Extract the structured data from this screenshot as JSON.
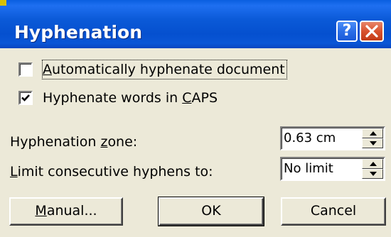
{
  "dialog": {
    "title": "Hyphenation",
    "help_glyph": "?",
    "close_icon": "close-x-icon",
    "colors": {
      "titlebar": "#0550cf",
      "close": "#d9532f",
      "face": "#ece9d8"
    }
  },
  "options": {
    "auto_hyphenate": {
      "label_pre": "",
      "label_key": "A",
      "label_post": "utomatically hyphenate document",
      "checked": false
    },
    "hyphenate_caps": {
      "label_pre": "Hyphenate words in ",
      "label_key": "C",
      "label_post": "APS",
      "checked": true
    }
  },
  "fields": {
    "zone": {
      "label_pre": "Hyphenation ",
      "label_key": "z",
      "label_post": "one:",
      "value": "0.63 cm"
    },
    "limit": {
      "label_pre": "",
      "label_key": "L",
      "label_post": "imit consecutive hyphens to:",
      "value": "No limit"
    }
  },
  "buttons": {
    "manual": {
      "label_key": "M",
      "label_post": "anual..."
    },
    "ok": {
      "label": "OK"
    },
    "cancel": {
      "label": "Cancel"
    }
  }
}
